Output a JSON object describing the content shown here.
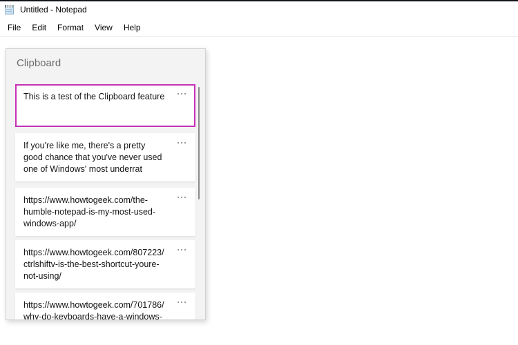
{
  "window": {
    "title": "Untitled - Notepad",
    "icon": "notepad-icon"
  },
  "menubar": {
    "items": [
      {
        "label": "File"
      },
      {
        "label": "Edit"
      },
      {
        "label": "Format"
      },
      {
        "label": "View"
      },
      {
        "label": "Help"
      }
    ]
  },
  "editor": {
    "content": ""
  },
  "clipboard": {
    "header": "Clipboard",
    "accent_color": "#c62fb5",
    "panel_background": "#f3f3f3",
    "card_background": "#ffffff",
    "overflow_icon": "ellipsis-icon",
    "items": [
      {
        "text": "This is a test of the Clipboard feature",
        "selected": true
      },
      {
        "text": "If you're like me, there's a pretty good chance that you've never used one of Windows' most underrat",
        "selected": false
      },
      {
        "text": "https://www.howtogeek.com/the-humble-notepad-is-my-most-used-windows-app/",
        "selected": false
      },
      {
        "text": "https://www.howtogeek.com/807223/ctrlshiftv-is-the-best-shortcut-youre-not-using/",
        "selected": false
      },
      {
        "text": "https://www.howtogeek.com/701786/why-do-keyboards-have-a-windows-",
        "selected": false
      }
    ]
  }
}
